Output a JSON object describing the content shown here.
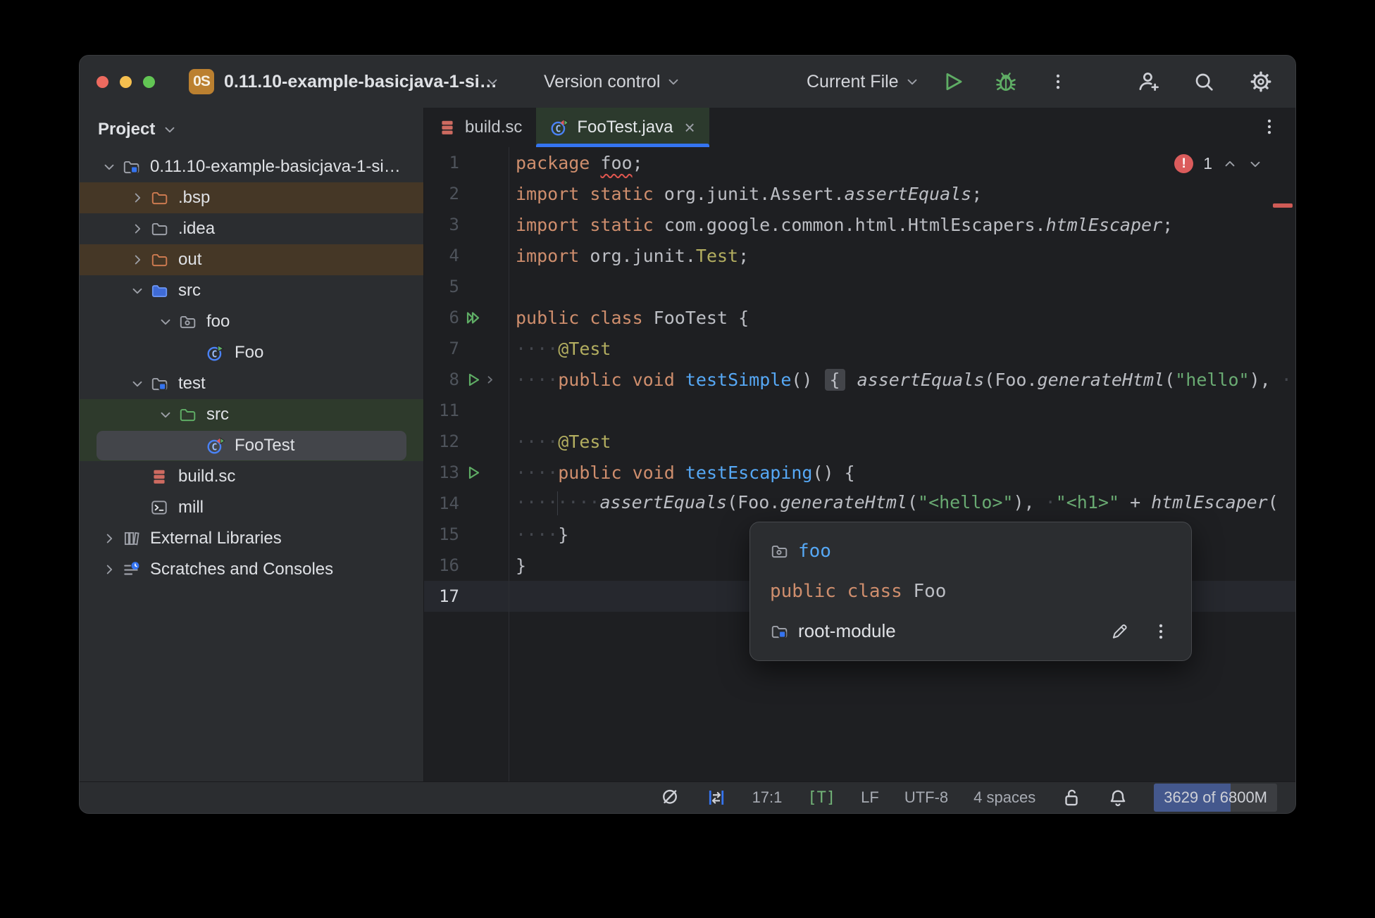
{
  "titlebar": {
    "project_badge": "0S",
    "title": "0.11.10-example-basicjava-1-si…",
    "version_control_label": "Version control",
    "run_config_label": "Current File"
  },
  "project_panel": {
    "header": "Project",
    "items": [
      {
        "label": "0.11.10-example-basicjava-1-si…",
        "indent": 0,
        "chevron": "down",
        "icon": "module-folder"
      },
      {
        "label": ".bsp",
        "indent": 1,
        "chevron": "right",
        "icon": "folder-excluded",
        "band": "excluded"
      },
      {
        "label": ".idea",
        "indent": 1,
        "chevron": "right",
        "icon": "folder"
      },
      {
        "label": "out",
        "indent": 1,
        "chevron": "right",
        "icon": "folder-excluded",
        "band": "excluded"
      },
      {
        "label": "src",
        "indent": 1,
        "chevron": "down",
        "icon": "folder-src"
      },
      {
        "label": "foo",
        "indent": 2,
        "chevron": "down",
        "icon": "package-folder"
      },
      {
        "label": "Foo",
        "indent": 3,
        "chevron": "none",
        "icon": "class-run"
      },
      {
        "label": "test",
        "indent": 1,
        "chevron": "down",
        "icon": "module-folder"
      },
      {
        "label": "src",
        "indent": 2,
        "chevron": "down",
        "icon": "folder-test",
        "band": "test"
      },
      {
        "label": "FooTest",
        "indent": 3,
        "chevron": "none",
        "icon": "test-class",
        "band": "test",
        "selected": true
      },
      {
        "label": "build.sc",
        "indent": 1,
        "chevron": "none",
        "icon": "scala-build"
      },
      {
        "label": "mill",
        "indent": 1,
        "chevron": "none",
        "icon": "terminal"
      },
      {
        "label": "External Libraries",
        "indent": 0,
        "chevron": "right",
        "icon": "libraries"
      },
      {
        "label": "Scratches and Consoles",
        "indent": 0,
        "chevron": "right",
        "icon": "scratches"
      }
    ]
  },
  "tabs": [
    {
      "label": "build.sc",
      "icon": "scala-build",
      "active": false
    },
    {
      "label": "FooTest.java",
      "icon": "test-class",
      "active": true,
      "close": "×"
    }
  ],
  "editor": {
    "error_count": "1",
    "lines": [
      {
        "num": "1",
        "tokens": [
          {
            "t": "package",
            "c": "kw"
          },
          {
            "t": " ",
            "c": "pl"
          },
          {
            "t": "foo",
            "c": "pl err"
          },
          {
            "t": ";",
            "c": "pl"
          }
        ]
      },
      {
        "num": "2",
        "tokens": [
          {
            "t": "import static",
            "c": "kw"
          },
          {
            "t": " org.junit.Assert.",
            "c": "pl"
          },
          {
            "t": "assertEquals",
            "c": "pl it"
          },
          {
            "t": ";",
            "c": "pl"
          }
        ]
      },
      {
        "num": "3",
        "tokens": [
          {
            "t": "import static",
            "c": "kw"
          },
          {
            "t": " com.google.common.html.HtmlEscapers.",
            "c": "pl"
          },
          {
            "t": "htmlEscaper",
            "c": "pl it"
          },
          {
            "t": ";",
            "c": "pl"
          }
        ]
      },
      {
        "num": "4",
        "tokens": [
          {
            "t": "import",
            "c": "kw"
          },
          {
            "t": " org.junit.",
            "c": "pl"
          },
          {
            "t": "Test",
            "c": "anno"
          },
          {
            "t": ";",
            "c": "pl"
          }
        ]
      },
      {
        "num": "5",
        "tokens": []
      },
      {
        "num": "6",
        "gutter": [
          "run-all"
        ],
        "tokens": [
          {
            "t": "public class",
            "c": "kw"
          },
          {
            "t": " FooTest {",
            "c": "pl"
          }
        ]
      },
      {
        "num": "7",
        "tokens": [
          {
            "t": "····",
            "c": "ws"
          },
          {
            "t": "@Test",
            "c": "anno"
          }
        ]
      },
      {
        "num": "8",
        "gutter": [
          "run",
          "fold-arrow"
        ],
        "tokens": [
          {
            "t": "····",
            "c": "ws"
          },
          {
            "t": "public void",
            "c": "kw"
          },
          {
            "t": " ",
            "c": "pl"
          },
          {
            "t": "testSimple",
            "c": "mth"
          },
          {
            "t": "() ",
            "c": "pl"
          },
          {
            "t": "{",
            "c": "pl fold"
          },
          {
            "t": " ",
            "c": "pl"
          },
          {
            "t": "assertEquals",
            "c": "pl it"
          },
          {
            "t": "(Foo.",
            "c": "pl"
          },
          {
            "t": "generateHtml",
            "c": "pl it"
          },
          {
            "t": "(",
            "c": "pl"
          },
          {
            "t": "\"hello\"",
            "c": "str"
          },
          {
            "t": "), ",
            "c": "pl"
          },
          {
            "t": "··",
            "c": "ws"
          }
        ]
      },
      {
        "num": "11",
        "tokens": []
      },
      {
        "num": "12",
        "tokens": [
          {
            "t": "····",
            "c": "ws"
          },
          {
            "t": "@Test",
            "c": "anno"
          }
        ]
      },
      {
        "num": "13",
        "gutter": [
          "run"
        ],
        "tokens": [
          {
            "t": "····",
            "c": "ws"
          },
          {
            "t": "public void",
            "c": "kw"
          },
          {
            "t": " ",
            "c": "pl"
          },
          {
            "t": "testEscaping",
            "c": "mth"
          },
          {
            "t": "() {",
            "c": "pl"
          }
        ]
      },
      {
        "num": "14",
        "tokens": [
          {
            "t": "····",
            "c": "ws"
          },
          {
            "t": "",
            "c": "guide"
          },
          {
            "t": "····",
            "c": "ws"
          },
          {
            "t": "assertEquals",
            "c": "pl it"
          },
          {
            "t": "(Foo.",
            "c": "pl"
          },
          {
            "t": "generateHtml",
            "c": "pl it"
          },
          {
            "t": "(",
            "c": "pl"
          },
          {
            "t": "\"<hello>\"",
            "c": "str"
          },
          {
            "t": "), ",
            "c": "pl"
          },
          {
            "t": "·",
            "c": "ws"
          },
          {
            "t": "\"<h1>\"",
            "c": "str"
          },
          {
            "t": " + ",
            "c": "pl"
          },
          {
            "t": "htmlEscaper",
            "c": "pl it"
          },
          {
            "t": "(",
            "c": "pl"
          }
        ]
      },
      {
        "num": "15",
        "tokens": [
          {
            "t": "····",
            "c": "ws"
          },
          {
            "t": "}",
            "c": "pl"
          }
        ]
      },
      {
        "num": "16",
        "tokens": [
          {
            "t": "}",
            "c": "pl"
          }
        ]
      },
      {
        "num": "17",
        "current": true,
        "tokens": []
      }
    ]
  },
  "popup": {
    "rows": [
      {
        "kind": "package",
        "icon": "package-folder",
        "text": "foo"
      },
      {
        "kind": "code",
        "tokens": [
          {
            "t": "public class",
            "c": "kw"
          },
          {
            "t": " Foo",
            "c": "pl"
          }
        ]
      },
      {
        "kind": "module",
        "icon": "module-folder",
        "text": "root-module",
        "actions": [
          "pencil",
          "kebab"
        ]
      }
    ]
  },
  "status_bar": {
    "items": [
      {
        "type": "icon",
        "icon": "inspections-off",
        "name": "inspections-widget"
      },
      {
        "type": "icon",
        "icon": "indent-guides",
        "name": "code-vision-widget"
      },
      {
        "type": "text",
        "label": "17:1",
        "name": "caret-position"
      },
      {
        "type": "badge",
        "label": "[T]",
        "name": "file-type-badge"
      },
      {
        "type": "text",
        "label": "LF",
        "name": "line-separator"
      },
      {
        "type": "text",
        "label": "UTF-8",
        "name": "encoding"
      },
      {
        "type": "text",
        "label": "4 spaces",
        "name": "indent-style"
      },
      {
        "type": "icon",
        "icon": "lock-open",
        "name": "readonly-toggle"
      },
      {
        "type": "icon",
        "icon": "bell",
        "name": "notifications"
      },
      {
        "type": "memory",
        "label": "3629 of 6800M",
        "name": "memory-indicator"
      }
    ]
  }
}
